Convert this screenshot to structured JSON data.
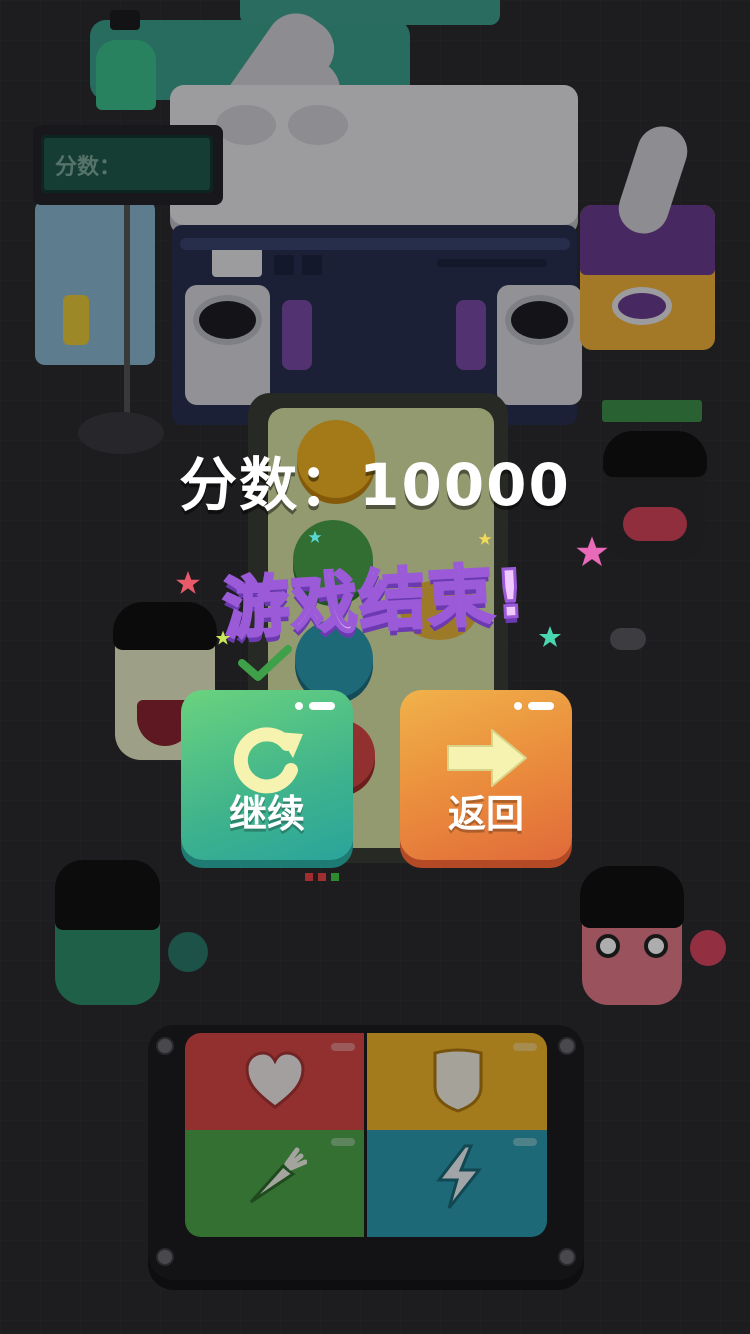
{
  "background": {
    "sign_label": "分数：",
    "colors": {
      "bg": "#2b2b2f",
      "accent_green": "#3fb38c",
      "accent_orange": "#e98a3c",
      "title_purple": "#9b5bd8"
    },
    "icons": {
      "pad": [
        "heart-icon",
        "shield-icon",
        "carrot-icon",
        "lightning-icon"
      ],
      "continue": "refresh-icon",
      "back": "arrow-right-icon"
    }
  },
  "overlay": {
    "score_label": "分数：",
    "score_value": "10000",
    "title": "游戏结束!",
    "buttons": {
      "continue_label": "继续",
      "back_label": "返回"
    }
  }
}
